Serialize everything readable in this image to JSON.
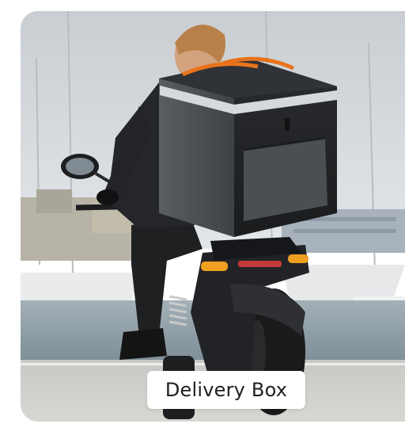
{
  "card": {
    "label": "Delivery Box",
    "image": "rider-on-scooter-with-thermal-delivery-box"
  },
  "colors": {
    "caption_background": "#ffffff",
    "caption_text": "#1f1f1f",
    "box_trim": "#e8731c",
    "sky": "#d9dee2",
    "water": "#8f9ea6"
  }
}
